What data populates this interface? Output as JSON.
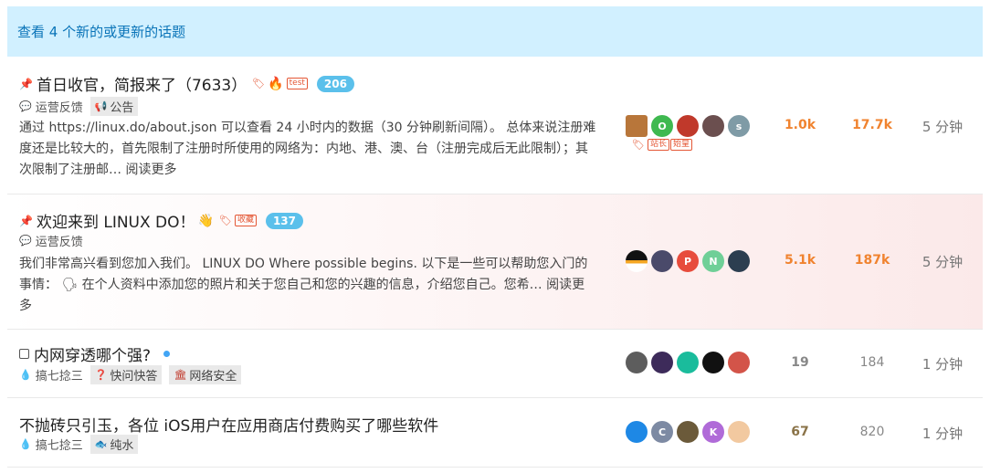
{
  "banner": {
    "text": "查看 4 个新的或更新的话题"
  },
  "topics": [
    {
      "title": "首日收官，简报来了（7633）",
      "tag_badge": "test",
      "reply_badge": "206",
      "category": "运营反馈",
      "tag": "公告",
      "excerpt": "通过 https://linux.do/about.json 可以查看 24 小时内的数据（30 分钟刷新间隔）。 总体来说注册难度还是比较大的，首先限制了注册时所使用的网络为：内地、港、澳、台（注册完成后无此限制）；其次限制了注册邮…",
      "read_more": "阅读更多",
      "flair_badges": [
        "站长",
        "始皇"
      ],
      "avatars": [
        "",
        "O",
        "",
        "",
        "s"
      ],
      "replies": "1.0k",
      "views": "17.7k",
      "activity": "5 分钟"
    },
    {
      "title": "欢迎来到 LINUX DO！",
      "tag_badge": "收藏",
      "reply_badge": "137",
      "category": "运营反馈",
      "excerpt": "我们非常高兴看到您加入我们。 LINUX DO Where possible begins. 以下是一些可以帮助您入门的事情： 🗣 在个人资料中添加您的照片和关于您自己和您的兴趣的信息，介绍您自己。您希…",
      "read_more": "阅读更多",
      "avatars": [
        "",
        "",
        "P",
        "N",
        ""
      ],
      "replies": "5.1k",
      "views": "187k",
      "activity": "5 分钟"
    },
    {
      "title": "内网穿透哪个强?",
      "category": "搞七捻三",
      "tag": "快问快答",
      "tag2": "网络安全",
      "avatars": [
        "",
        "",
        "",
        "",
        ""
      ],
      "replies": "19",
      "views": "184",
      "activity": "1 分钟"
    },
    {
      "title": "不抛砖只引玉，各位 iOS用户在应用商店付费购买了哪些软件",
      "category": "搞七捻三",
      "tag": "纯水",
      "avatars": [
        "",
        "C",
        "",
        "K",
        ""
      ],
      "replies": "67",
      "views": "820",
      "activity": "1 分钟"
    }
  ],
  "colors": {
    "banner_bg": "#d1f0ff",
    "banner_text": "#0a74b8",
    "hot_stat": "#f0832f",
    "reply_badge": "#5bc0eb"
  }
}
